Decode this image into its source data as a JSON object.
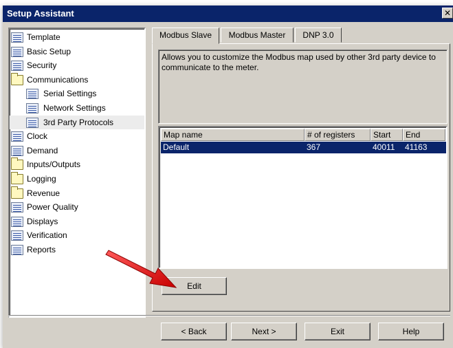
{
  "window": {
    "title": "Setup Assistant",
    "close_label": "✕"
  },
  "sidebar": {
    "items": [
      {
        "label": "Template",
        "icon": "doc-icon",
        "level": 0
      },
      {
        "label": "Basic Setup",
        "icon": "doc-icon",
        "level": 0
      },
      {
        "label": "Security",
        "icon": "doc-icon",
        "level": 0
      },
      {
        "label": "Communications",
        "icon": "folder-icon",
        "level": 0
      },
      {
        "label": "Serial Settings",
        "icon": "doc-icon",
        "level": 1
      },
      {
        "label": "Network Settings",
        "icon": "doc-icon",
        "level": 1
      },
      {
        "label": "3rd Party Protocols",
        "icon": "doc-icon",
        "level": 1,
        "selected": true
      },
      {
        "label": "Clock",
        "icon": "doc-icon",
        "level": 0
      },
      {
        "label": "Demand",
        "icon": "doc-icon",
        "level": 0
      },
      {
        "label": "Inputs/Outputs",
        "icon": "folder-icon",
        "level": 0
      },
      {
        "label": "Logging",
        "icon": "folder-icon",
        "level": 0
      },
      {
        "label": "Revenue",
        "icon": "folder-icon",
        "level": 0
      },
      {
        "label": "Power Quality",
        "icon": "doc-icon",
        "level": 0
      },
      {
        "label": "Displays",
        "icon": "doc-icon",
        "level": 0
      },
      {
        "label": "Verification",
        "icon": "doc-icon",
        "level": 0
      },
      {
        "label": "Reports",
        "icon": "doc-icon",
        "level": 0
      }
    ]
  },
  "tabs": [
    {
      "label": "Modbus Slave",
      "active": true
    },
    {
      "label": "Modbus Master",
      "active": false
    },
    {
      "label": "DNP 3.0",
      "active": false
    }
  ],
  "description": "Allows you to customize the Modbus map used by other 3rd party device to communicate to the meter.",
  "map_table": {
    "columns": [
      "Map name",
      "# of registers",
      "Start",
      "End"
    ],
    "rows": [
      {
        "map_name": "Default",
        "registers": "367",
        "start": "40011",
        "end": "41163",
        "selected": true
      }
    ]
  },
  "buttons": {
    "edit": "Edit",
    "back": "< Back",
    "next": "Next >",
    "exit": "Exit",
    "help": "Help"
  },
  "colors": {
    "title_bar": "#0a246a",
    "selection": "#0a246a",
    "face": "#d4d0c8",
    "arrow": "#e02020"
  }
}
